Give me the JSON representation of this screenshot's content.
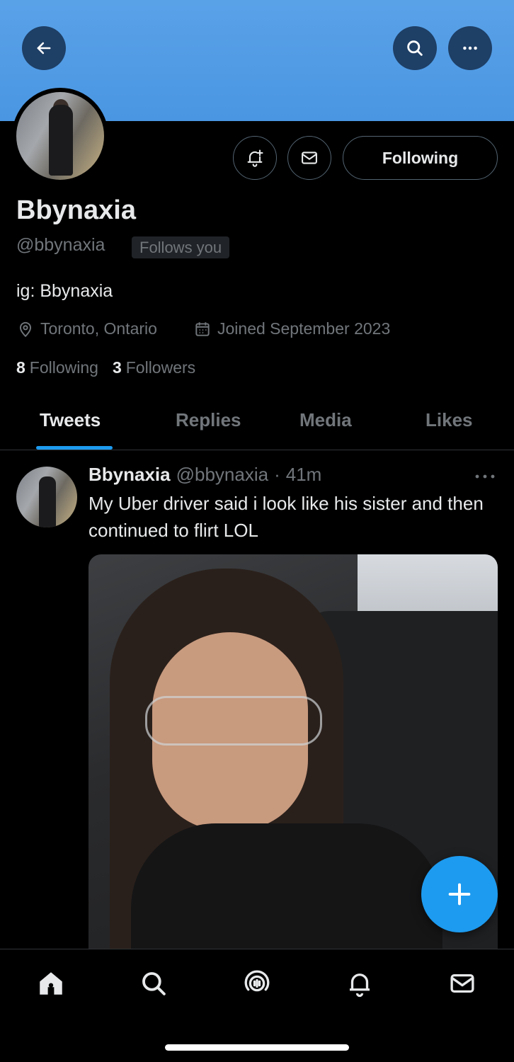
{
  "header": {
    "back_icon": "arrow-left-icon",
    "search_icon": "search-icon",
    "more_icon": "more-horizontal-icon",
    "banner_color": "#4a96e2"
  },
  "profile": {
    "display_name": "Bbynaxia",
    "handle": "@bbynaxia",
    "follows_you_label": "Follows you",
    "bio": "ig: Bbynaxia",
    "location": "Toronto, Ontario",
    "joined": "Joined September 2023",
    "following_count": "8",
    "following_label": "Following",
    "followers_count": "3",
    "followers_label": "Followers",
    "notify_icon": "bell-plus-icon",
    "message_icon": "mail-icon",
    "following_button_label": "Following"
  },
  "tabs": [
    {
      "label": "Tweets",
      "active": true
    },
    {
      "label": "Replies",
      "active": false
    },
    {
      "label": "Media",
      "active": false
    },
    {
      "label": "Likes",
      "active": false
    }
  ],
  "tweet": {
    "name": "Bbynaxia",
    "handle": "@bbynaxia",
    "separator": "·",
    "time": "41m",
    "text": "My Uber driver said i look like his sister and then continued to flirt LOL",
    "has_media": true
  },
  "fab": {
    "icon": "plus-icon",
    "color": "#1d9bf0"
  },
  "bottom_nav": [
    {
      "icon": "home-icon",
      "active": true
    },
    {
      "icon": "search-icon",
      "active": false
    },
    {
      "icon": "spaces-icon",
      "active": false
    },
    {
      "icon": "bell-icon",
      "active": false
    },
    {
      "icon": "mail-icon",
      "active": false
    }
  ],
  "colors": {
    "accent": "#1d9bf0",
    "text_primary": "#e7e9ea",
    "text_secondary": "#71767b",
    "background": "#000000"
  }
}
